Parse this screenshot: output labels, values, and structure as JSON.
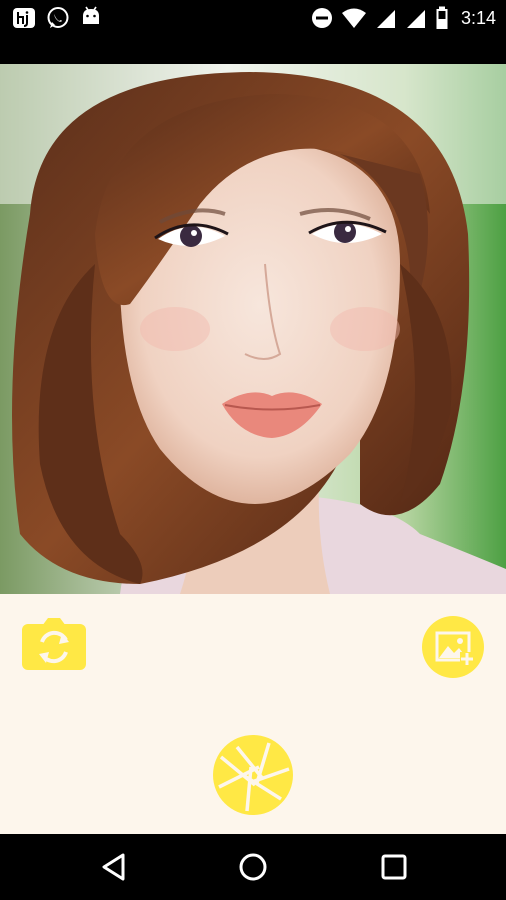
{
  "status_bar": {
    "time": "3:14",
    "left_icons": [
      "hj-app-icon",
      "whatsapp-icon",
      "android-icon"
    ],
    "right_icons": [
      "do-not-disturb-icon",
      "wifi-icon",
      "signal-icon",
      "signal-icon",
      "battery-icon"
    ]
  },
  "preview": {
    "subject": "camera-preview-portrait"
  },
  "controls": {
    "switch_camera_icon": "switch-camera-icon",
    "gallery_icon": "add-photo-icon",
    "shutter_icon": "shutter-icon",
    "accent_color": "#FFE845",
    "background_color": "#FDF6EC"
  },
  "nav_bar": {
    "back_icon": "back-icon",
    "home_icon": "home-icon",
    "recents_icon": "recents-icon"
  }
}
